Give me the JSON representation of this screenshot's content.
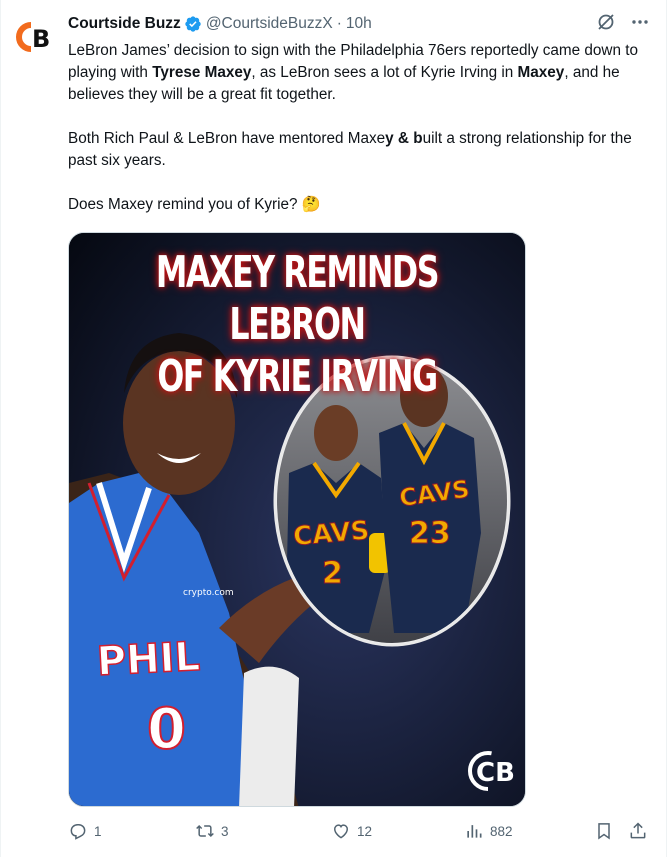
{
  "tweet": {
    "author_name": "Courtside Buzz",
    "author_handle": "@CourtsideBuzzX",
    "separator": "·",
    "time": "10h",
    "avatar_text": "CB",
    "text_parts": {
      "p1_a": "LeBron James’ decision to sign with the Philadelphia 76ers reportedly came down to playing with ",
      "p1_b": "Tyrese Maxey",
      "p1_c": ", as LeBron sees a lot of Kyrie Irving in ",
      "p1_d": "Maxey",
      "p1_e": ", and he believes they will be a great fit together.",
      "p2_a": "Both Rich Paul & LeBron have mentored Maxe",
      "p2_b": "y & b",
      "p2_c": "uilt a strong relationship for the past six years.",
      "p3": "Does Maxey remind you of Kyrie? 🤔"
    },
    "media": {
      "headline_line1": "MAXEY REMINDS LEBRON",
      "headline_line2": "OF KYRIE IRVING",
      "left_jersey_text": "PHIL",
      "left_jersey_number": "0",
      "sponsor_text": "crypto.com",
      "kyrie_jersey_text": "CAVS",
      "kyrie_jersey_number": "2",
      "lebron_jersey_text": "CAVS",
      "lebron_jersey_number": "23",
      "watermark_text": "CB"
    },
    "stats": {
      "replies": "1",
      "reposts": "3",
      "likes": "12",
      "views": "882"
    }
  },
  "colors": {
    "brand_orange": "#f26b1d",
    "verified_blue": "#1d9bf0",
    "muted_text": "#536471",
    "sixers_blue": "#1d4ea8",
    "cavs_navy": "#1a2a4e",
    "cavs_gold": "#f2a900",
    "headline_glow": "#c21414"
  }
}
